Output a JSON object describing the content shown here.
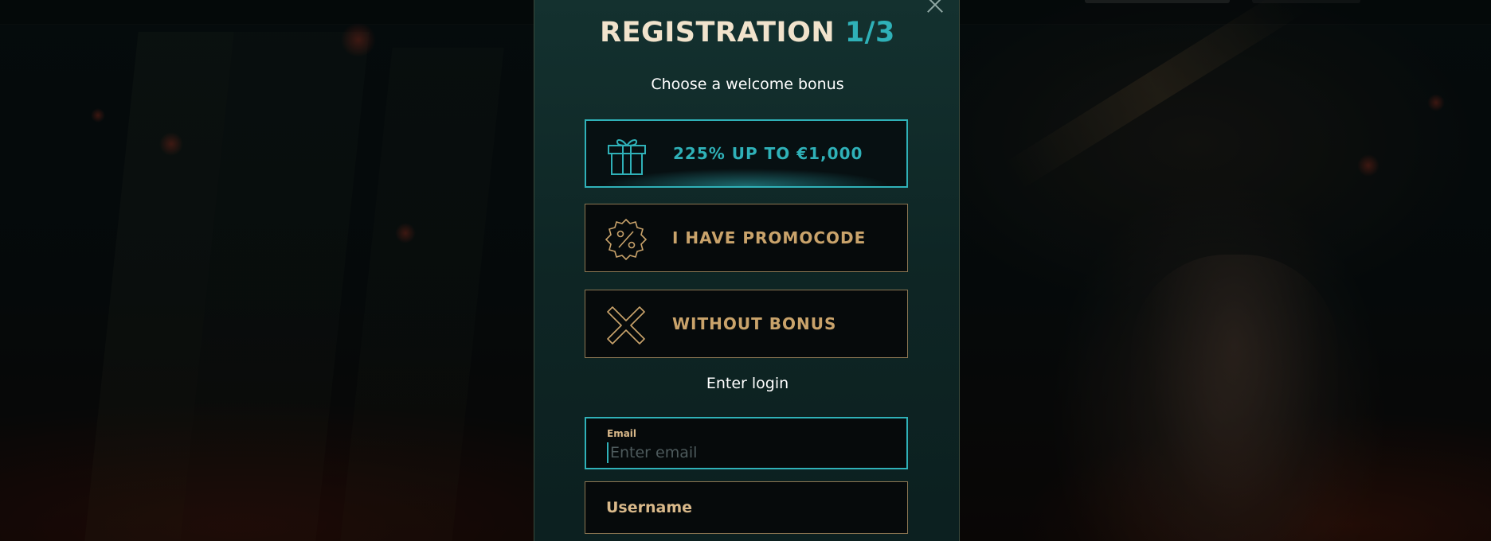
{
  "modal": {
    "title_main": "REGISTRATION",
    "title_step": "1/3",
    "subtitle": "Choose a welcome bonus",
    "bonus_options": [
      {
        "label": "225% UP TO €1,000",
        "icon": "gift-icon",
        "selected": true
      },
      {
        "label": "I HAVE PROMOCODE",
        "icon": "percent-badge-icon",
        "selected": false
      },
      {
        "label": "WITHOUT BONUS",
        "icon": "x-cross-icon",
        "selected": false
      }
    ],
    "login_label": "Enter login",
    "email": {
      "label": "Email",
      "placeholder": "Enter email",
      "value": ""
    },
    "username": {
      "placeholder": "Username"
    }
  },
  "colors": {
    "accent_teal": "#2fb1b8",
    "accent_gold": "#c9a36b",
    "title_cream": "#f1e3cc",
    "modal_bg": "#0e2625",
    "field_bg": "#060a0b"
  }
}
